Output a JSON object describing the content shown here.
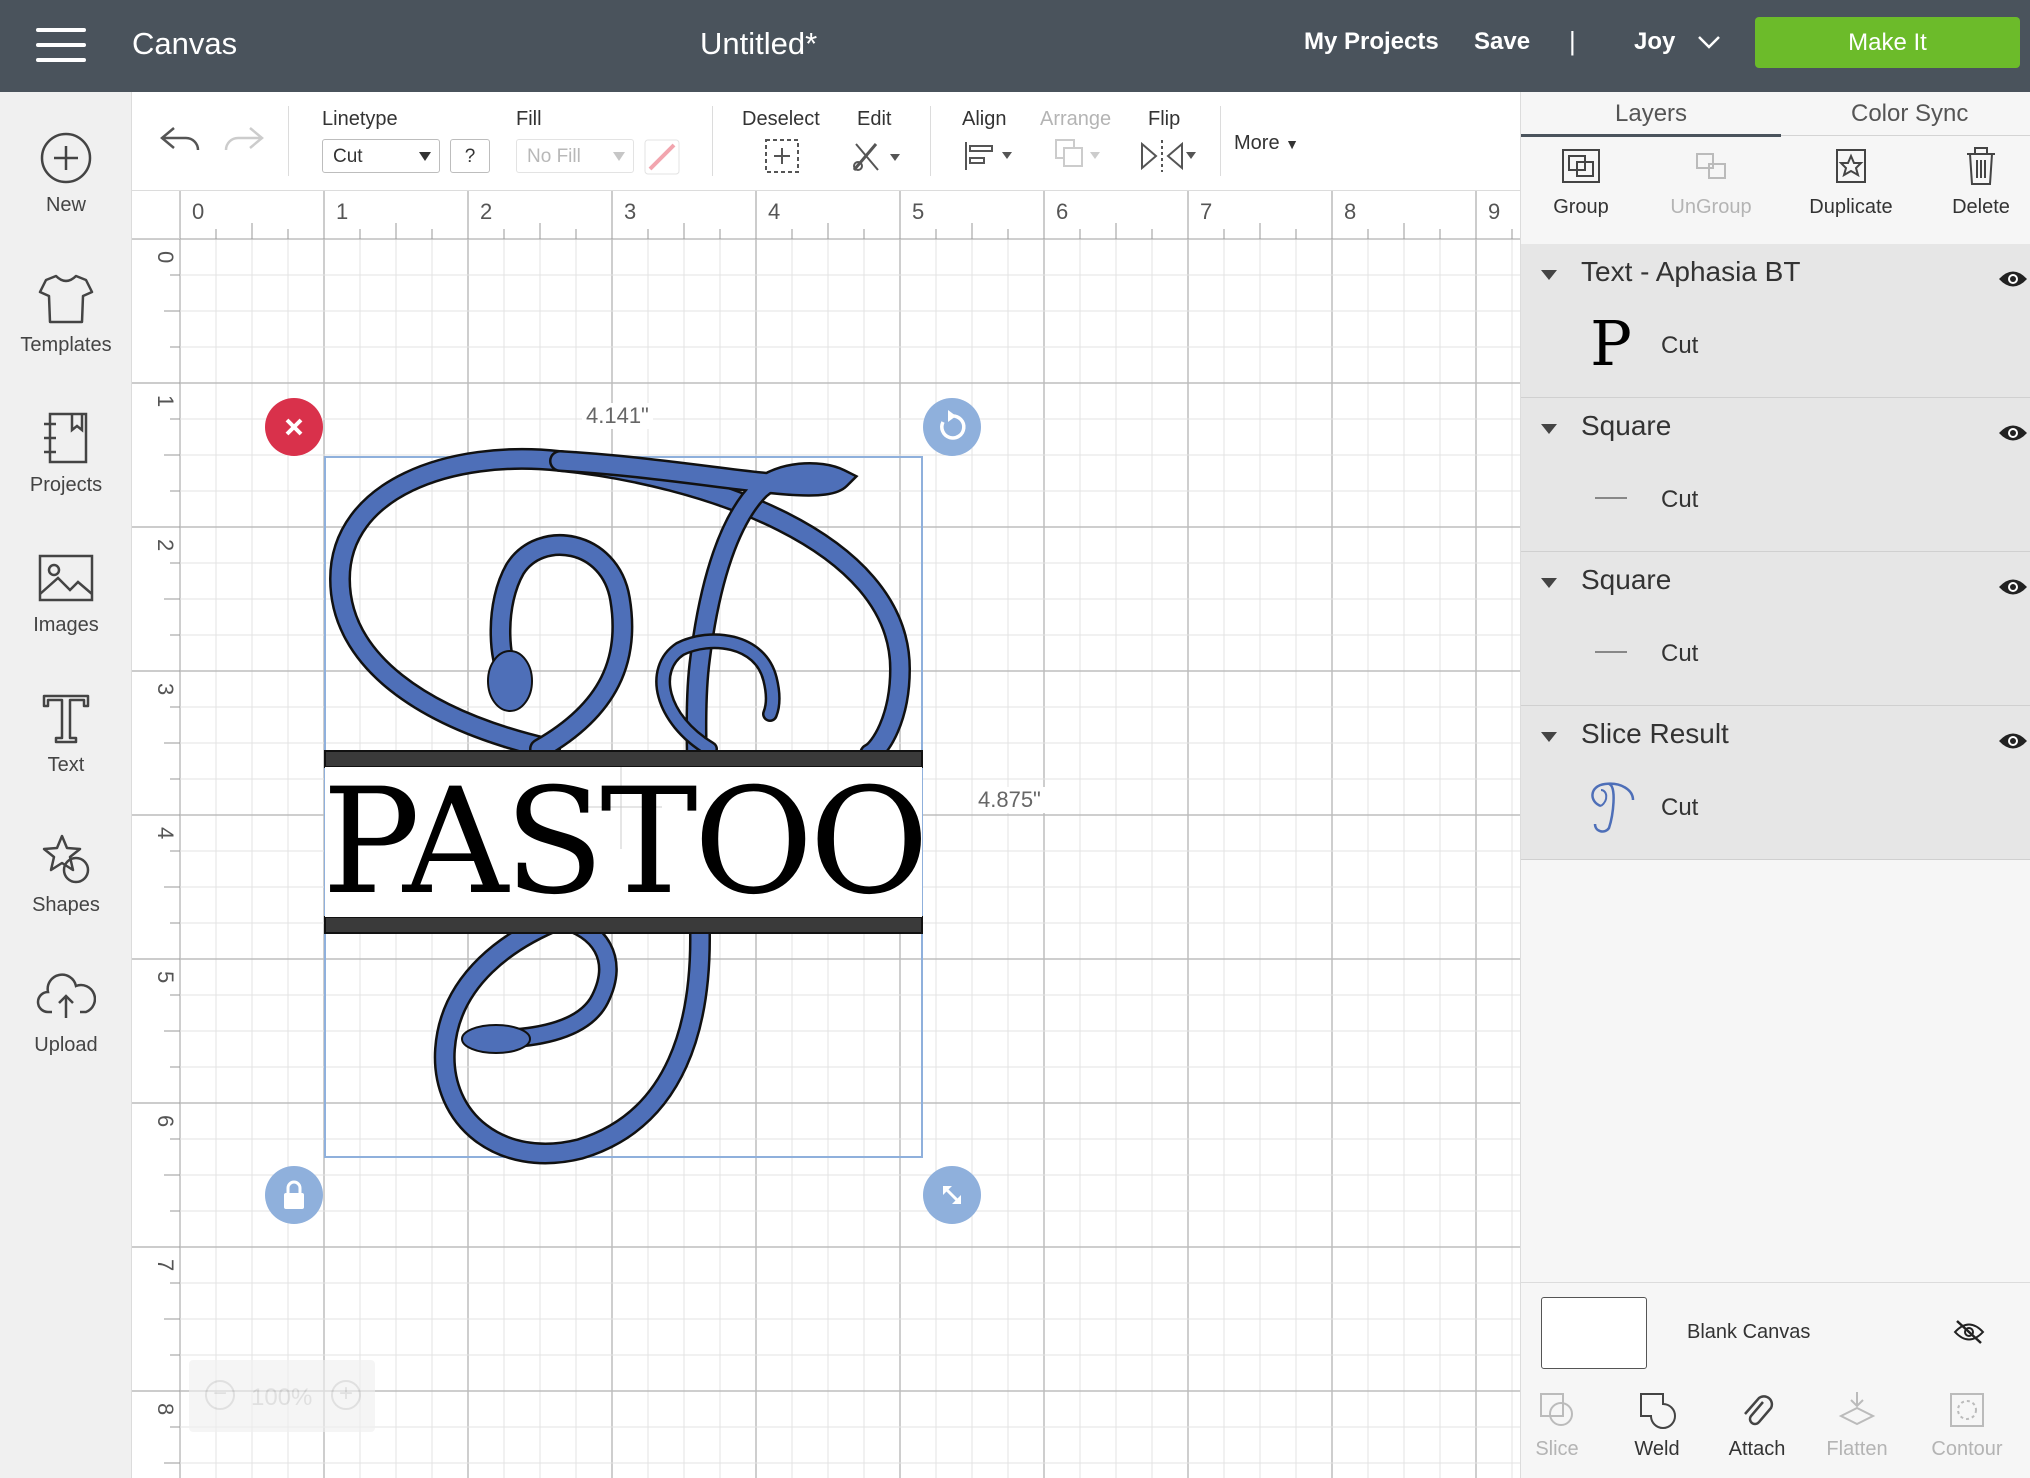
{
  "topbar": {
    "app_name": "Canvas",
    "doc_title": "Untitled*",
    "my_projects": "My Projects",
    "save": "Save",
    "separator": "|",
    "user_name": "Joy",
    "make_it": "Make It",
    "bg_color": "#4a535c",
    "make_it_color": "#6cbb2a"
  },
  "sidebar": {
    "items": [
      {
        "label": "New",
        "icon": "plus-circle-icon"
      },
      {
        "label": "Templates",
        "icon": "tshirt-icon"
      },
      {
        "label": "Projects",
        "icon": "notebook-icon"
      },
      {
        "label": "Images",
        "icon": "image-icon"
      },
      {
        "label": "Text",
        "icon": "text-t-icon"
      },
      {
        "label": "Shapes",
        "icon": "shapes-icon"
      },
      {
        "label": "Upload",
        "icon": "cloud-upload-icon"
      }
    ]
  },
  "toolbar": {
    "linetype_label": "Linetype",
    "linetype_value": "Cut",
    "help": "?",
    "fill_label": "Fill",
    "fill_value": "No Fill",
    "deselect_label": "Deselect",
    "edit_label": "Edit",
    "align_label": "Align",
    "arrange_label": "Arrange",
    "flip_label": "Flip",
    "more_label": "More"
  },
  "rulers": {
    "top": [
      "0",
      "1",
      "2",
      "3",
      "4",
      "5",
      "6",
      "7",
      "8",
      "9"
    ],
    "left": [
      "0",
      "1",
      "2",
      "3",
      "4",
      "5",
      "6",
      "7",
      "8"
    ]
  },
  "canvas": {
    "width_label": "4.141\"",
    "height_label": "4.875\"",
    "monogram_text": "PASTOOR",
    "monogram_color": "#4e6fb8",
    "delete_handle_color": "#d9314b",
    "handle_color": "#8fb0dc",
    "zoom_minus": "−",
    "zoom_value": "100%",
    "zoom_plus": "+"
  },
  "right_panel": {
    "tabs": [
      "Layers",
      "Color Sync"
    ],
    "actions": [
      {
        "label": "Group",
        "enabled": true
      },
      {
        "label": "UnGroup",
        "enabled": false
      },
      {
        "label": "Duplicate",
        "enabled": true
      },
      {
        "label": "Delete",
        "enabled": true
      }
    ],
    "layers": [
      {
        "title": "Text - Aphasia BT",
        "sub": "Cut"
      },
      {
        "title": "Square",
        "sub": "Cut"
      },
      {
        "title": "Square",
        "sub": "Cut"
      },
      {
        "title": "Slice Result",
        "sub": "Cut"
      }
    ],
    "text_thumb_glyph": "P",
    "blank_canvas": "Blank Canvas",
    "bottom_tools": [
      {
        "label": "Slice",
        "enabled": false
      },
      {
        "label": "Weld",
        "enabled": true
      },
      {
        "label": "Attach",
        "enabled": true
      },
      {
        "label": "Flatten",
        "enabled": false
      },
      {
        "label": "Contour",
        "enabled": false
      }
    ]
  }
}
